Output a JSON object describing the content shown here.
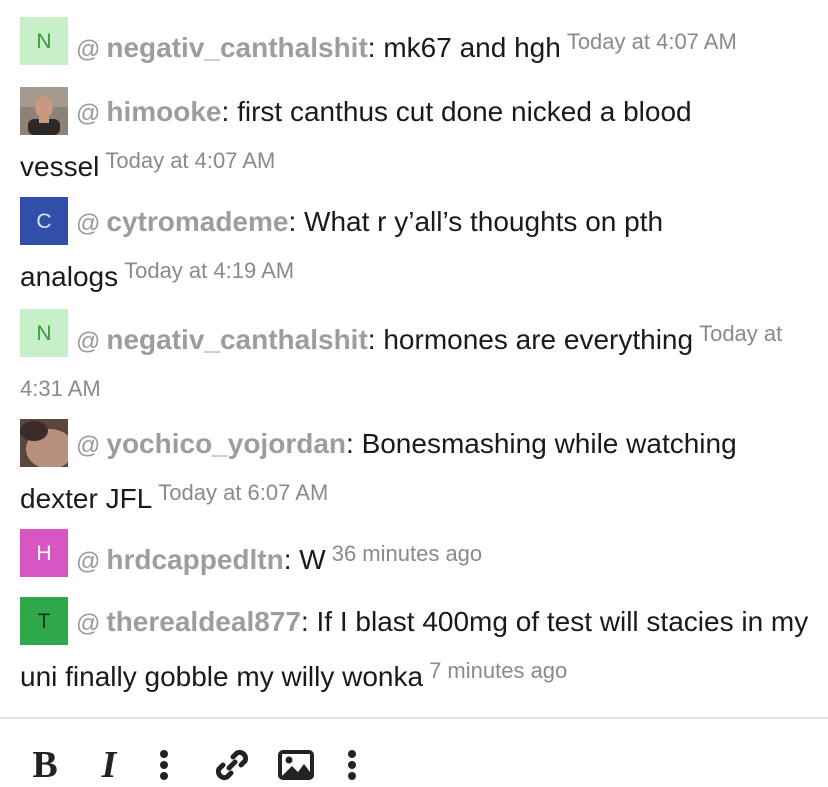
{
  "messages": [
    {
      "avatar": {
        "type": "letter",
        "letter": "N",
        "bg": "#c8f0c8",
        "fg": "#3a9a3a"
      },
      "at": "@",
      "username": "negativ_canthalshit",
      "text": "mk67 and hgh",
      "timestamp": "Today at 4:07 AM"
    },
    {
      "avatar": {
        "type": "photo",
        "description": "man-portrait"
      },
      "at": "@",
      "username": "himooke",
      "text": "first canthus cut done nicked a blood vessel",
      "timestamp": "Today at 4:07 AM"
    },
    {
      "avatar": {
        "type": "letter",
        "letter": "C",
        "bg": "#2f4fa8",
        "fg": "#d9e2ff"
      },
      "at": "@",
      "username": "cytromademe",
      "text": "What r y’all’s thoughts on pth analogs",
      "timestamp": "Today at 4:19 AM"
    },
    {
      "avatar": {
        "type": "letter",
        "letter": "N",
        "bg": "#c8f0c8",
        "fg": "#3a9a3a"
      },
      "at": "@",
      "username": "negativ_canthalshit",
      "text": "hormones are everything",
      "timestamp": "Today at 4:31 AM"
    },
    {
      "avatar": {
        "type": "photo",
        "description": "skin-closeup"
      },
      "at": "@",
      "username": "yochico_yojordan",
      "text": "Bonesmashing while watching dexter JFL",
      "timestamp": "Today at 6:07 AM"
    },
    {
      "avatar": {
        "type": "letter",
        "letter": "H",
        "bg": "#d656c4",
        "fg": "#ffffff"
      },
      "at": "@",
      "username": "hrdcappedltn",
      "text": "W",
      "timestamp": "36 minutes ago"
    },
    {
      "avatar": {
        "type": "letter",
        "letter": "T",
        "bg": "#2fa84a",
        "fg": "#0f3a18"
      },
      "at": "@",
      "username": "therealdeal877",
      "text": "If I blast 400mg of test will stacies in my uni finally gobble my willy wonka",
      "timestamp": "7 minutes ago"
    }
  ],
  "toolbar": {
    "bold_label": "B",
    "italic_label": "I",
    "icons": [
      "bold-icon",
      "italic-icon",
      "more-vertical-icon",
      "link-icon",
      "image-icon",
      "more-vertical-icon"
    ]
  }
}
